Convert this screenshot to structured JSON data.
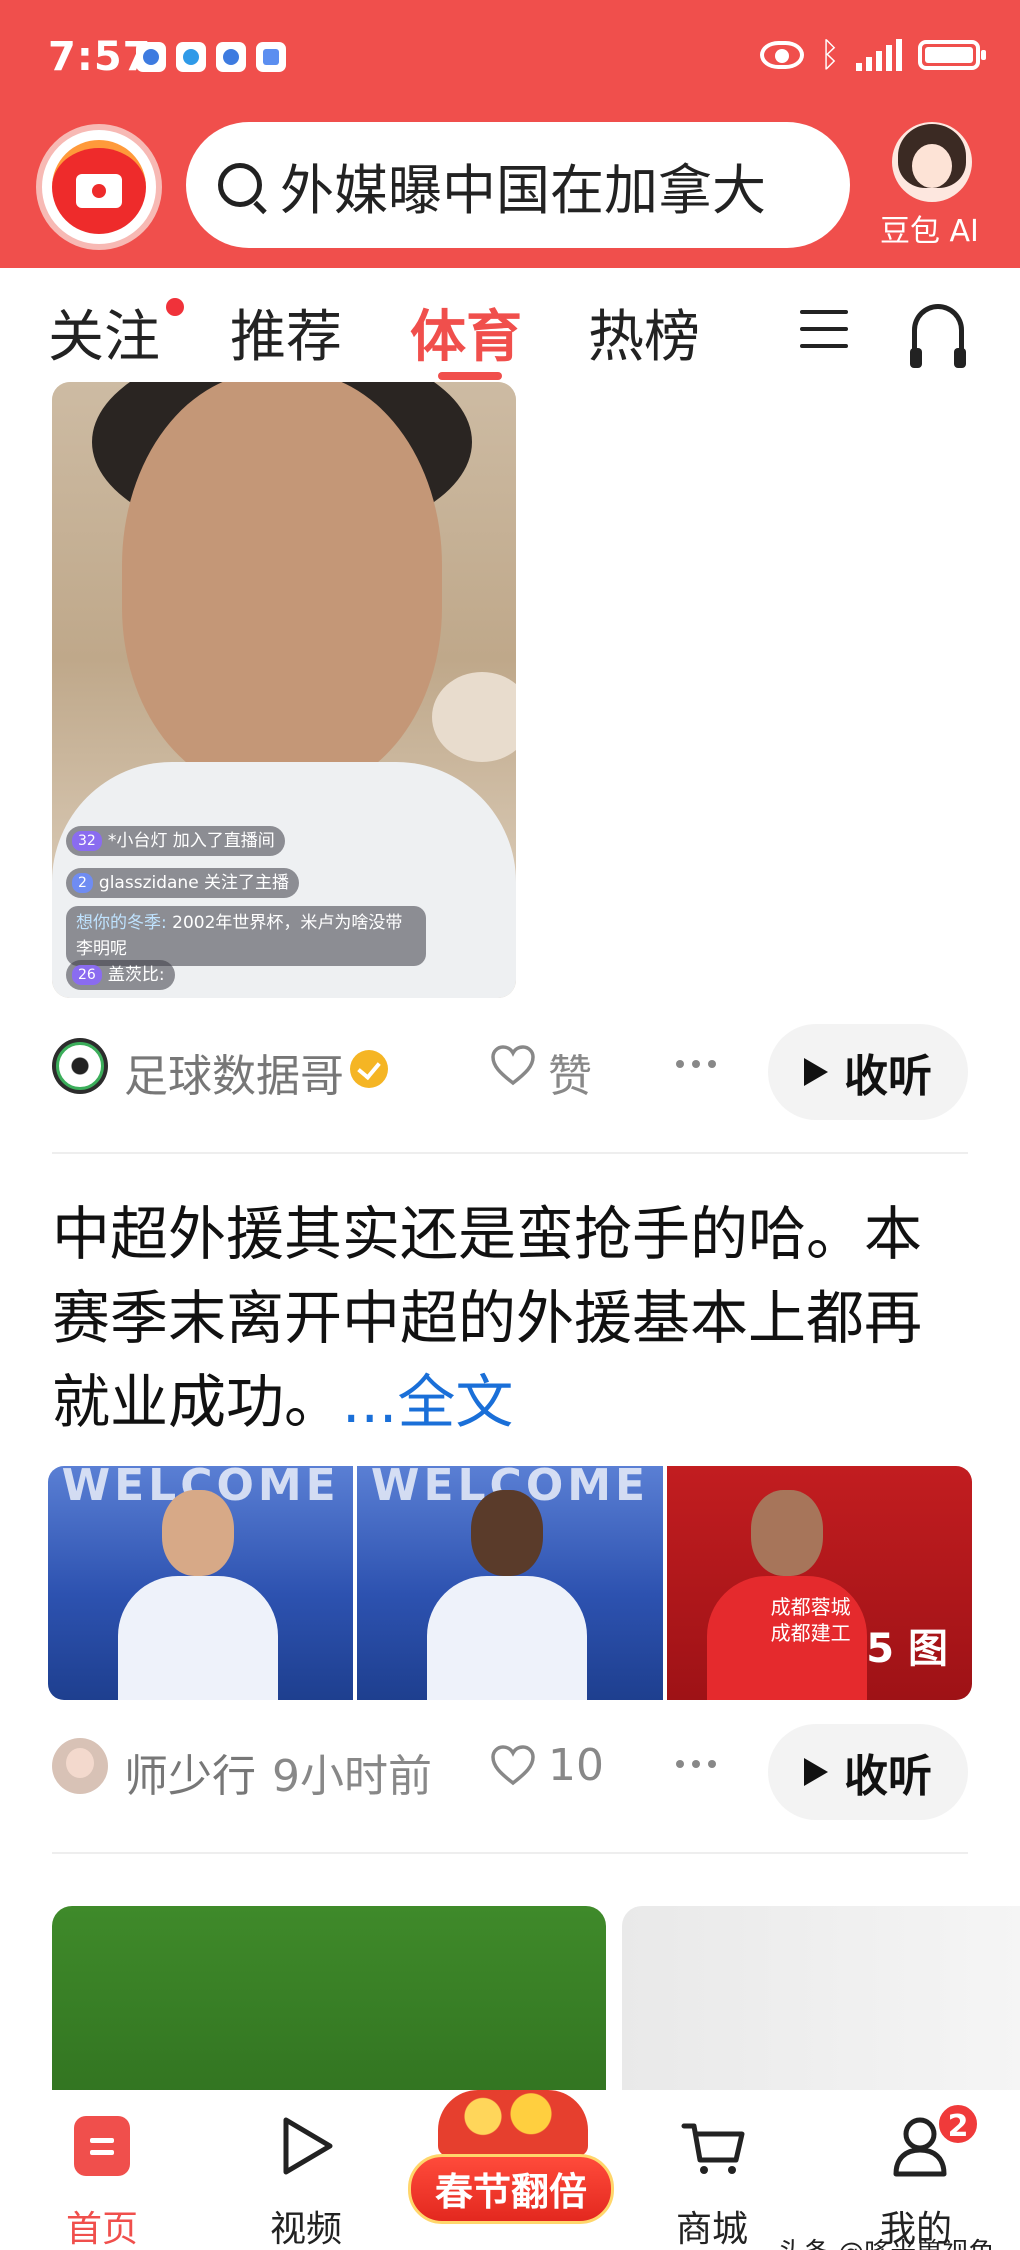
{
  "status_bar": {
    "time": "7:57",
    "icons": [
      "baidu-icon",
      "browser-icon",
      "cloud-icon",
      "music-icon",
      "eye-icon",
      "bluetooth-icon",
      "signal-icon",
      "battery-icon"
    ]
  },
  "header": {
    "search_query": "外媒曝中国在加拿大",
    "ai_label": "豆包 AI",
    "brand_color": "#f04f4c"
  },
  "tabs": [
    {
      "label": "关注",
      "has_dot": true
    },
    {
      "label": "推荐"
    },
    {
      "label": "体育",
      "active": true
    },
    {
      "label": "热榜"
    }
  ],
  "feed": {
    "card1": {
      "chat_messages": [
        {
          "level": "32",
          "text": "*小台灯 加入了直播间"
        },
        {
          "level": "2",
          "text": "glasszidane 关注了主播"
        },
        {
          "level": "26",
          "text": "盖茨比:"
        }
      ],
      "chat_note_user": "想你的冬季:",
      "chat_note_text": "2002年世界杯，米卢为啥没带李明呢",
      "author": "足球数据哥",
      "like_label": "赞",
      "listen_label": "收听"
    },
    "card2": {
      "text": "中超外援其实还是蛮抢手的哈。本赛季末离开中超的外援基本上都再就业成功。",
      "full_text_link": "...全文",
      "image_banner_text": "WELCOME",
      "image3_text": "成都蓉城\n成都建工",
      "photo_count": "5 图",
      "author": "师少行",
      "time_ago": "9小时前",
      "like_count": "10",
      "listen_label": "收听"
    }
  },
  "bottom_nav": {
    "items": [
      {
        "label": "首页",
        "active": true
      },
      {
        "label": "视频"
      },
      {
        "label": "春节翻倍"
      },
      {
        "label": "商城"
      },
      {
        "label": "我的",
        "badge": "2"
      }
    ]
  },
  "watermark": "头条 @哆米兽视角"
}
